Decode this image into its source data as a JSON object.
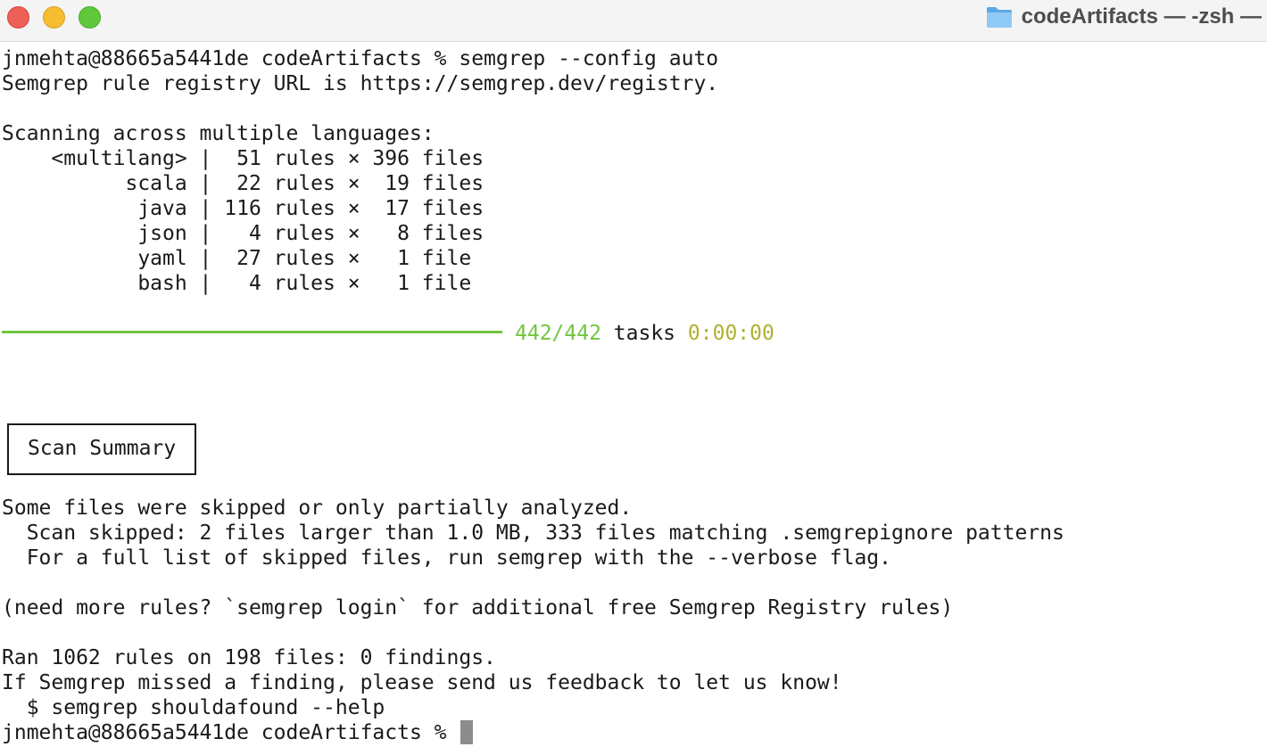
{
  "window": {
    "title": "codeArtifacts — -zsh —",
    "folder_icon": "folder-icon",
    "controls": [
      "close",
      "minimize",
      "zoom"
    ]
  },
  "terminal": {
    "command_line": "jnmehta@88665a5441de codeArtifacts % semgrep --config auto",
    "registry_line": "Semgrep rule registry URL is https://semgrep.dev/registry.",
    "scanning_header": "Scanning across multiple languages:",
    "languages": [
      "    <multilang> |  51 rules × 396 files",
      "          scala |  22 rules ×  19 files",
      "           java | 116 rules ×  17 files",
      "           json |   4 rules ×   8 files",
      "           yaml |  27 rules ×   1 file",
      "           bash |   4 rules ×   1 file"
    ],
    "progress": {
      "fraction": 1.0,
      "count": "442/442",
      "label": "tasks",
      "time": "0:00:00",
      "bar_color": "#71c540",
      "time_color": "#b0b030"
    },
    "summary_title": "Scan Summary",
    "skipped_line": "Some files were skipped or only partially analyzed.",
    "skipped_detail": "  Scan skipped: 2 files larger than 1.0 MB, 333 files matching .semgrepignore patterns",
    "verbose_hint": "  For a full list of skipped files, run semgrep with the --verbose flag.",
    "login_hint": "(need more rules? `semgrep login` for additional free Semgrep Registry rules)",
    "ran_line": "Ran 1062 rules on 198 files: 0 findings.",
    "feedback_line": "If Semgrep missed a finding, please send us feedback to let us know!",
    "shouldafound_line": "  $ semgrep shouldafound --help",
    "final_prompt": "jnmehta@88665a5441de codeArtifacts % "
  }
}
